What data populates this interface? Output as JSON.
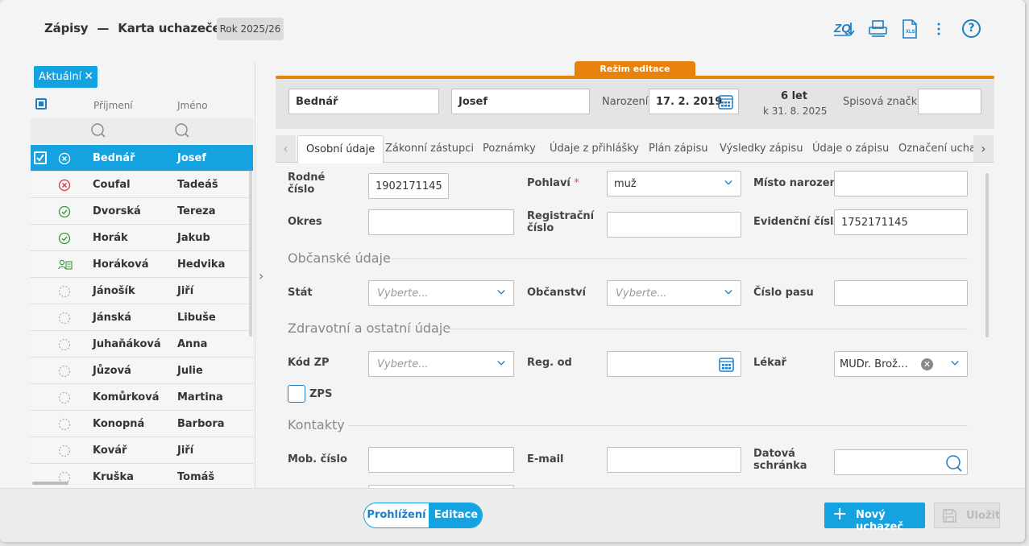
{
  "header": {
    "module": "Zápisy",
    "separator": "—",
    "title": "Karta uchazeče",
    "year": "Rok 2025/26"
  },
  "toolbar": {
    "icons": [
      "export-icon",
      "print-icon",
      "xls-export-icon",
      "more-vertical-icon",
      "help-icon"
    ],
    "xls_label": "XLS",
    "help_label": "?"
  },
  "filter": {
    "chip_label": "Aktuální"
  },
  "list": {
    "col_surname": "Příjmení",
    "col_name": "Jméno",
    "rows": [
      {
        "surname": "Bednář",
        "name": "Josef",
        "status": "rejected",
        "selected": true
      },
      {
        "surname": "Coufal",
        "name": "Tadeáš",
        "status": "rejected"
      },
      {
        "surname": "Dvorská",
        "name": "Tereza",
        "status": "accepted"
      },
      {
        "surname": "Horák",
        "name": "Jakub",
        "status": "accepted"
      },
      {
        "surname": "Horáková",
        "name": "Hedvika",
        "status": "registered"
      },
      {
        "surname": "Jánošík",
        "name": "Jiří",
        "status": "pending"
      },
      {
        "surname": "Jánská",
        "name": "Libuše",
        "status": "pending"
      },
      {
        "surname": "Juhaňáková",
        "name": "Anna",
        "status": "pending"
      },
      {
        "surname": "Jůzová",
        "name": "Julie",
        "status": "pending"
      },
      {
        "surname": "Komůrková",
        "name": "Martina",
        "status": "pending"
      },
      {
        "surname": "Konopná",
        "name": "Barbora",
        "status": "pending"
      },
      {
        "surname": "Kovář",
        "name": "Jiří",
        "status": "pending"
      },
      {
        "surname": "Kruška",
        "name": "Tomáš",
        "status": "pending"
      }
    ]
  },
  "mode": {
    "label": "Režim editace",
    "color": "#e8820c"
  },
  "ident": {
    "surname": "Bednář",
    "first_name": "Josef",
    "birth_label": "Narození",
    "birth_date": "17. 2. 2019",
    "age": "6 let",
    "age_ref": "k 31. 8. 2025",
    "file_label": "Spisová značka",
    "file_value": ""
  },
  "tabs": [
    {
      "label": "Osobní údaje",
      "active": true
    },
    {
      "label": "Zákonní zástupci"
    },
    {
      "label": "Poznámky"
    },
    {
      "label": "Údaje z přihlášky"
    },
    {
      "label": "Plán zápisu"
    },
    {
      "label": "Výsledky zápisu"
    },
    {
      "label": "Údaje o zápisu"
    },
    {
      "label": "Označení uchaz"
    }
  ],
  "form": {
    "rodne_cislo": {
      "label_1": "Rodné",
      "label_2": "číslo",
      "value": "1902171145"
    },
    "pohlavi": {
      "label": "Pohlaví",
      "required_mark": "*",
      "value": "muž"
    },
    "misto_narozeni": {
      "label": "Místo narození",
      "value": ""
    },
    "okres": {
      "label": "Okres",
      "value": ""
    },
    "registracni_cislo": {
      "label_1": "Registrační",
      "label_2": "číslo",
      "value": ""
    },
    "evidencni_cislo": {
      "label": "Evidenční číslo",
      "value": "1752171145"
    },
    "section_civic": "Občanské údaje",
    "stat": {
      "label": "Stát",
      "placeholder": "Vyberte..."
    },
    "obcanstvi": {
      "label": "Občanství",
      "placeholder": "Vyberte..."
    },
    "cislo_pasu": {
      "label": "Číslo pasu",
      "value": ""
    },
    "section_health": "Zdravotní a ostatní údaje",
    "kod_zp": {
      "label": "Kód ZP",
      "placeholder": "Vyberte..."
    },
    "reg_od": {
      "label": "Reg. od",
      "value": ""
    },
    "lekar": {
      "label": "Lékař",
      "value": "MUDr. Brož…"
    },
    "zps": {
      "label": "ZPS",
      "checked": false
    },
    "section_contacts": "Kontakty",
    "mob_cislo": {
      "label": "Mob. číslo",
      "value": ""
    },
    "email": {
      "label": "E-mail",
      "value": ""
    },
    "datova_schranka": {
      "label_1": "Datová",
      "label_2": "schránka",
      "value": ""
    }
  },
  "footer": {
    "view_label": "Prohlížení",
    "edit_label": "Editace",
    "new_label": "Nový uchazeč",
    "new_plus": "+",
    "save_label": "Uložit"
  },
  "colors": {
    "accent": "#15a2e0",
    "brand_blue": "#1e7fc4",
    "edit_orange": "#e8820c"
  }
}
